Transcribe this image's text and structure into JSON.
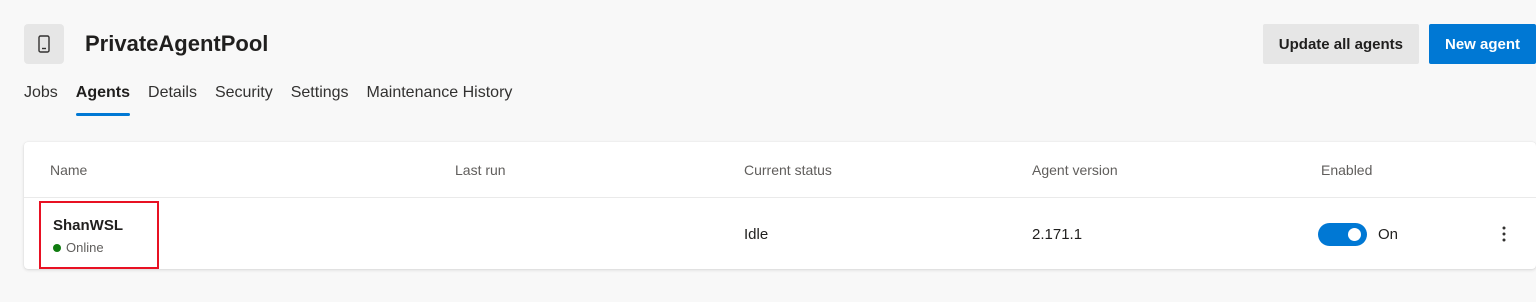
{
  "header": {
    "title": "PrivateAgentPool",
    "icon": "phone-device-icon",
    "update_label": "Update all agents",
    "new_agent_label": "New agent"
  },
  "tabs": [
    {
      "label": "Jobs",
      "active": false
    },
    {
      "label": "Agents",
      "active": true
    },
    {
      "label": "Details",
      "active": false
    },
    {
      "label": "Security",
      "active": false
    },
    {
      "label": "Settings",
      "active": false
    },
    {
      "label": "Maintenance History",
      "active": false
    }
  ],
  "table": {
    "columns": [
      "Name",
      "Last run",
      "Current status",
      "Agent version",
      "Enabled"
    ],
    "rows": [
      {
        "name": "ShanWSL",
        "state": "Online",
        "last_run": "",
        "current_status": "Idle",
        "agent_version": "2.171.1",
        "enabled_label": "On",
        "enabled": true
      }
    ]
  },
  "colors": {
    "accent": "#0078d4",
    "online": "#107c10",
    "highlight": "#e81123"
  }
}
